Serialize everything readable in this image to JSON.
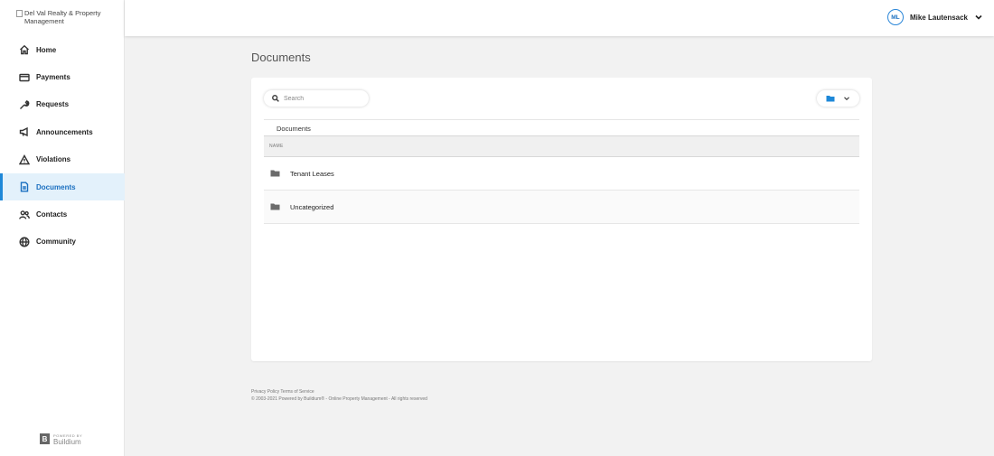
{
  "logo": {
    "alt_text": "Del Val Realty & Property Management"
  },
  "sidebar": {
    "items": [
      {
        "label": "Home",
        "icon": "home-icon",
        "active": false
      },
      {
        "label": "Payments",
        "icon": "credit-card-icon",
        "active": false
      },
      {
        "label": "Requests",
        "icon": "wrench-icon",
        "active": false
      },
      {
        "label": "Announcements",
        "icon": "megaphone-icon",
        "active": false
      },
      {
        "label": "Violations",
        "icon": "warning-icon",
        "active": false
      },
      {
        "label": "Documents",
        "icon": "document-icon",
        "active": true
      },
      {
        "label": "Contacts",
        "icon": "contacts-icon",
        "active": false
      },
      {
        "label": "Community",
        "icon": "globe-icon",
        "active": false
      }
    ],
    "powered_by": {
      "small": "POWERED BY",
      "brand": "Buildium"
    }
  },
  "header": {
    "user": {
      "initials": "ML",
      "name": "Mike Lautensack"
    }
  },
  "main": {
    "title": "Documents",
    "search": {
      "placeholder": "Search",
      "value": ""
    },
    "breadcrumb": "Documents",
    "table": {
      "column_header": "NAME",
      "rows": [
        {
          "name": "Tenant Leases",
          "icon": "folder-icon"
        },
        {
          "name": "Uncategorized",
          "icon": "folder-icon"
        }
      ]
    }
  },
  "footer": {
    "links": "Privacy Policy  Terms of Service",
    "copyright": "© 2003-2021 Powered by Buildium® - Online Property Management - All rights reserved"
  },
  "colors": {
    "accent": "#1e88d8",
    "active_bg": "#e3f1fb",
    "background": "#f2f2f2"
  }
}
